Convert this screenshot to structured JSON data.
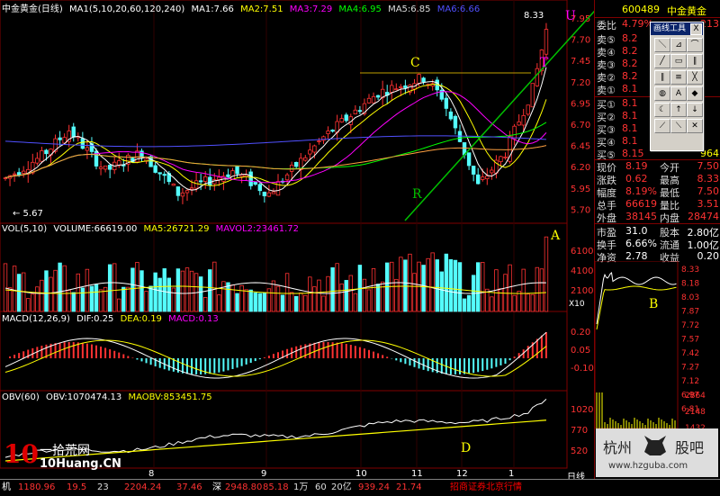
{
  "main": {
    "title": "中金黄金(日线)",
    "ma_label": "MA1(5,10,20,60,120,240)",
    "ma1": "MA1:7.66",
    "ma2": "MA2:7.51",
    "ma3": "MA3:7.29",
    "ma4": "MA4:6.95",
    "ma5": "MA5:6.85",
    "ma6": "MA6:6.66",
    "low_mark": "5.67",
    "high_mark": "8.33",
    "letters": {
      "C": "C",
      "R": "R",
      "T": "T",
      "U": "U"
    },
    "price_axis": [
      "7.95",
      "7.70",
      "7.45",
      "7.20",
      "6.95",
      "6.70",
      "6.45",
      "6.20",
      "5.95",
      "5.70"
    ],
    "colors": {
      "up": "#ff3232",
      "down": "#54fcfc",
      "ma5": "#ffffff",
      "ma10": "#ffff00",
      "ma20": "#ff00ff",
      "ma60": "#00ff00",
      "ma120": "#5050ff",
      "ma240": "#ffa040",
      "trend": "#00c000",
      "bg": "#000000",
      "grid": "#800000"
    }
  },
  "volume": {
    "label": "VOL(5,10)",
    "volume": "VOLUME:66619.00",
    "ma5": "MA5:26721.29",
    "mavol2": "MAVOL2:23461.72",
    "letter": "A",
    "axis": [
      "6100",
      "4100",
      "2100"
    ],
    "unit": "X10"
  },
  "macd": {
    "label": "MACD(12,26,9)",
    "dif": "DIF:0.25",
    "dea": "DEA:0.19",
    "macd": "MACD:0.13",
    "axis": [
      "0.20",
      "0.05",
      "-0.10"
    ]
  },
  "obv": {
    "label": "OBV(60)",
    "obv": "OBV:1070474.13",
    "maobv": "MAOBV:853451.75",
    "letter": "D",
    "axis": [
      "1020",
      "770",
      "520"
    ]
  },
  "months": [
    "8",
    "9",
    "10",
    "11",
    "12",
    "1"
  ],
  "period_label": "日线",
  "quote": {
    "code": "600489",
    "name": "中金黄金",
    "ratio_label": "委比",
    "ratio_value": "4.79%",
    "diff_label": "委差",
    "diff_value": "213",
    "sell": [
      {
        "label": "卖⑤",
        "price": "8.2",
        "vol": ""
      },
      {
        "label": "卖④",
        "price": "8.2",
        "vol": ""
      },
      {
        "label": "卖③",
        "price": "8.2",
        "vol": ""
      },
      {
        "label": "卖②",
        "price": "8.2",
        "vol": ""
      },
      {
        "label": "卖①",
        "price": "8.1",
        "vol": ""
      }
    ],
    "buy": [
      {
        "label": "买①",
        "price": "8.1",
        "vol": ""
      },
      {
        "label": "买②",
        "price": "8.1",
        "vol": ""
      },
      {
        "label": "买③",
        "price": "8.1",
        "vol": ""
      },
      {
        "label": "买④",
        "price": "8.1",
        "vol": ""
      },
      {
        "label": "买⑤",
        "price": "8.15",
        "vol": "964"
      }
    ],
    "stats": [
      {
        "l1": "现价",
        "v1": "8.19",
        "l2": "今开",
        "v2": "7.50"
      },
      {
        "l1": "涨跌",
        "v1": "0.62",
        "l2": "最高",
        "v2": "8.33"
      },
      {
        "l1": "幅度",
        "v1": "8.19%",
        "l2": "最低",
        "v2": "7.50"
      },
      {
        "l1": "总手",
        "v1": "66619",
        "l2": "量比",
        "v2": "3.51"
      },
      {
        "l1": "外盘",
        "v1": "38145",
        "l2": "内盘",
        "v2": "28474"
      }
    ],
    "fund": [
      {
        "l1": "市盈",
        "v1": "31.0",
        "l2": "股本",
        "v2": "2.80亿"
      },
      {
        "l1": "换手",
        "v1": "6.66%",
        "l2": "流通",
        "v2": "1.00亿"
      },
      {
        "l1": "净资",
        "v1": "2.78",
        "l2": "收益",
        "v2": "0.20"
      }
    ]
  },
  "tick": {
    "axis": [
      "8.33",
      "8.18",
      "8.03",
      "7.87",
      "7.72",
      "7.57",
      "7.42",
      "7.27",
      "7.12",
      "6.97",
      "6.81"
    ],
    "vol_axis": [
      "2864",
      "2148",
      "1432",
      "716"
    ],
    "letter": "B"
  },
  "tools": {
    "title": "画线工具",
    "close": "X",
    "items": [
      "＼",
      "⊿",
      "⌒",
      "╱",
      "▭",
      "∥",
      "∥",
      "≡",
      "╳",
      "◍",
      "A",
      "◆",
      "☾",
      "↑",
      "↓",
      "⟋",
      "⟍",
      "✕"
    ]
  },
  "bottom": {
    "prefix": "机",
    "idx1": "1180.96",
    "idx1b": "19.5",
    "idx1c": "23",
    "idx2": "2204.24",
    "idx2b": "37.46",
    "idx3_label": "深",
    "idx3": "2948.80",
    "idx3b": "85.18",
    "idx3c": "1万",
    "idx3d": "60",
    "idx3e": "20亿",
    "idx4": "939.24",
    "idx4b": "21.74",
    "broker": "招商证券北京行情"
  },
  "logos": {
    "left_num": "10",
    "left_cn": "一拾荒网",
    "left_url": "10Huang.CN",
    "right_a": "杭州",
    "right_b": "股吧",
    "right_url": "www.hzguba.com"
  }
}
